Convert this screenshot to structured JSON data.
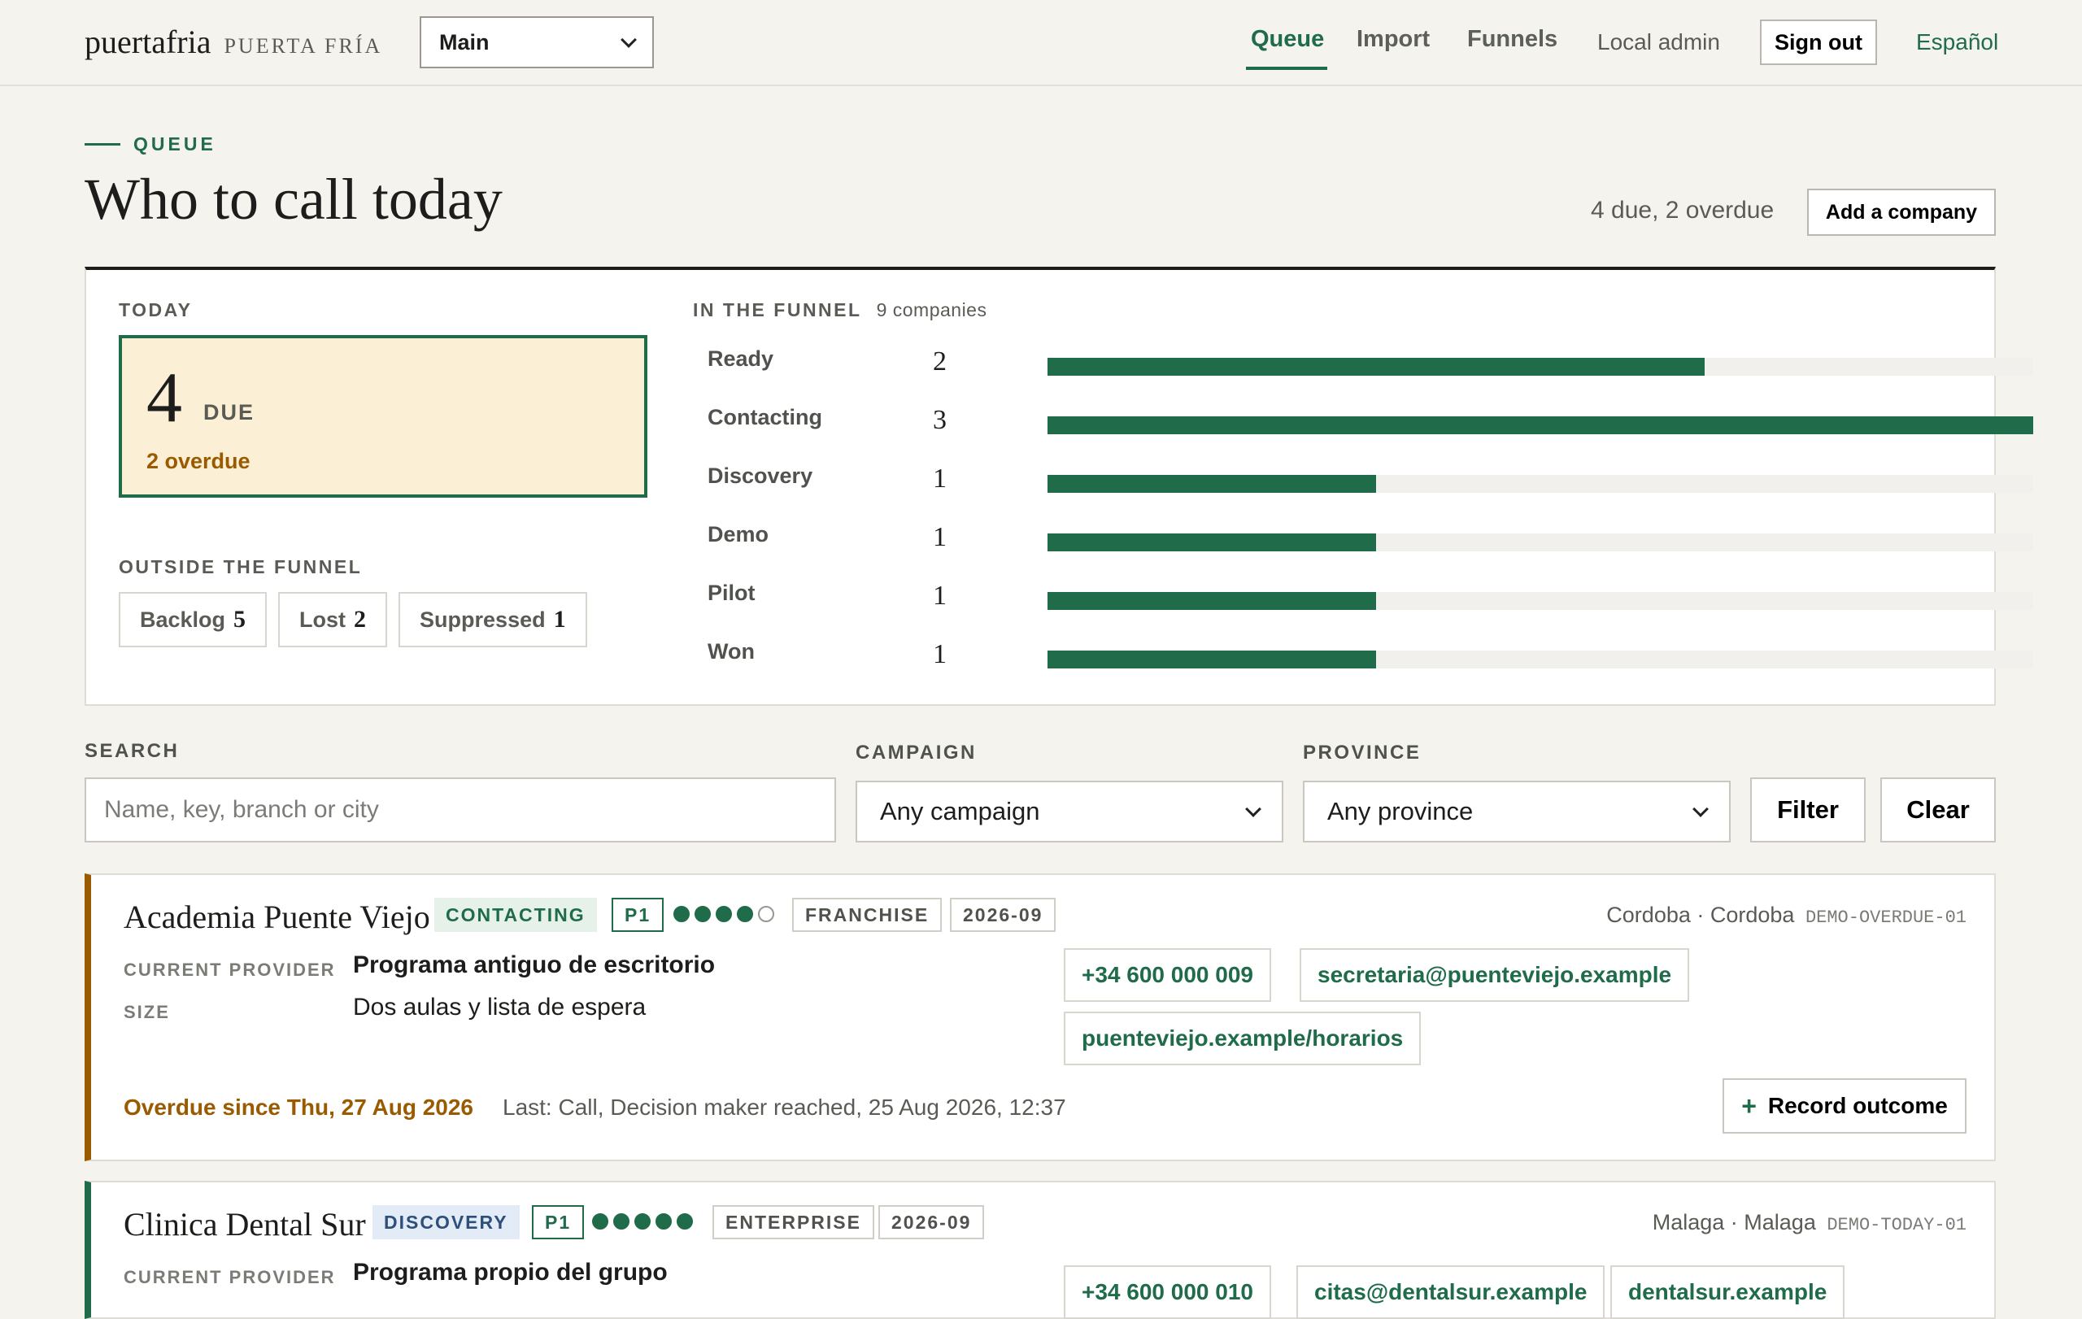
{
  "brand": {
    "name": "puertafria",
    "subtitle": "PUERTA FRÍA"
  },
  "workspace": {
    "selected": "Main"
  },
  "nav": {
    "items": [
      {
        "label": "Queue",
        "active": true
      },
      {
        "label": "Import",
        "active": false
      },
      {
        "label": "Funnels",
        "active": false
      }
    ],
    "user": "Local admin",
    "sign_out": "Sign out",
    "language": "Español"
  },
  "header": {
    "eyebrow": "QUEUE",
    "title": "Who to call today",
    "summary": "4 due, 2 overdue",
    "add_company": "Add a company"
  },
  "today": {
    "label": "TODAY",
    "due_count": "4",
    "due_label": "DUE",
    "overdue": "2 overdue"
  },
  "outside": {
    "label": "OUTSIDE THE FUNNEL",
    "chips": [
      {
        "label": "Backlog",
        "count": "5"
      },
      {
        "label": "Lost",
        "count": "2"
      },
      {
        "label": "Suppressed",
        "count": "1"
      }
    ]
  },
  "funnel": {
    "label": "IN THE FUNNEL",
    "companies": "9 companies",
    "max": 3,
    "stages": [
      {
        "name": "Ready",
        "count": 2
      },
      {
        "name": "Contacting",
        "count": 3
      },
      {
        "name": "Discovery",
        "count": 1
      },
      {
        "name": "Demo",
        "count": 1
      },
      {
        "name": "Pilot",
        "count": 1
      },
      {
        "name": "Won",
        "count": 1
      }
    ]
  },
  "filters": {
    "search_label": "SEARCH",
    "search_placeholder": "Name, key, branch or city",
    "search_value": "",
    "campaign_label": "CAMPAIGN",
    "campaign_value": "Any campaign",
    "province_label": "PROVINCE",
    "province_value": "Any province",
    "filter_button": "Filter",
    "clear_button": "Clear"
  },
  "colors": {
    "accent_green": "#1f6b4a",
    "overdue_amber": "#9a5a00",
    "due_background": "#fbf0d6"
  },
  "companies": [
    {
      "name": "Academia Puente Viejo",
      "stage": "CONTACTING",
      "priority": "P1",
      "rating": 4,
      "rating_max": 5,
      "segment": "FRANCHISE",
      "cohort": "2026-09",
      "location": "Cordoba · Cordoba",
      "key": "DEMO-OVERDUE-01",
      "provider_label": "CURRENT PROVIDER",
      "provider": "Programa antiguo de escritorio",
      "size_label": "SIZE",
      "size": "Dos aulas y lista de espera",
      "phone": "+34 600 000 009",
      "email": "secretaria@puenteviejo.example",
      "website": "puenteviejo.example/horarios",
      "due_note": "Overdue since Thu, 27 Aug 2026",
      "last_note": "Last: Call, Decision maker reached, 25 Aug 2026, 12:37",
      "record_button": "Record outcome"
    },
    {
      "name": "Clinica Dental Sur",
      "stage": "DISCOVERY",
      "priority": "P1",
      "rating": 5,
      "rating_max": 5,
      "segment": "ENTERPRISE",
      "cohort": "2026-09",
      "location": "Malaga · Malaga",
      "key": "DEMO-TODAY-01",
      "provider_label": "CURRENT PROVIDER",
      "provider": "Programa propio del grupo",
      "phone": "+34 600 000 010",
      "email": "citas@dentalsur.example",
      "website": "dentalsur.example"
    }
  ]
}
